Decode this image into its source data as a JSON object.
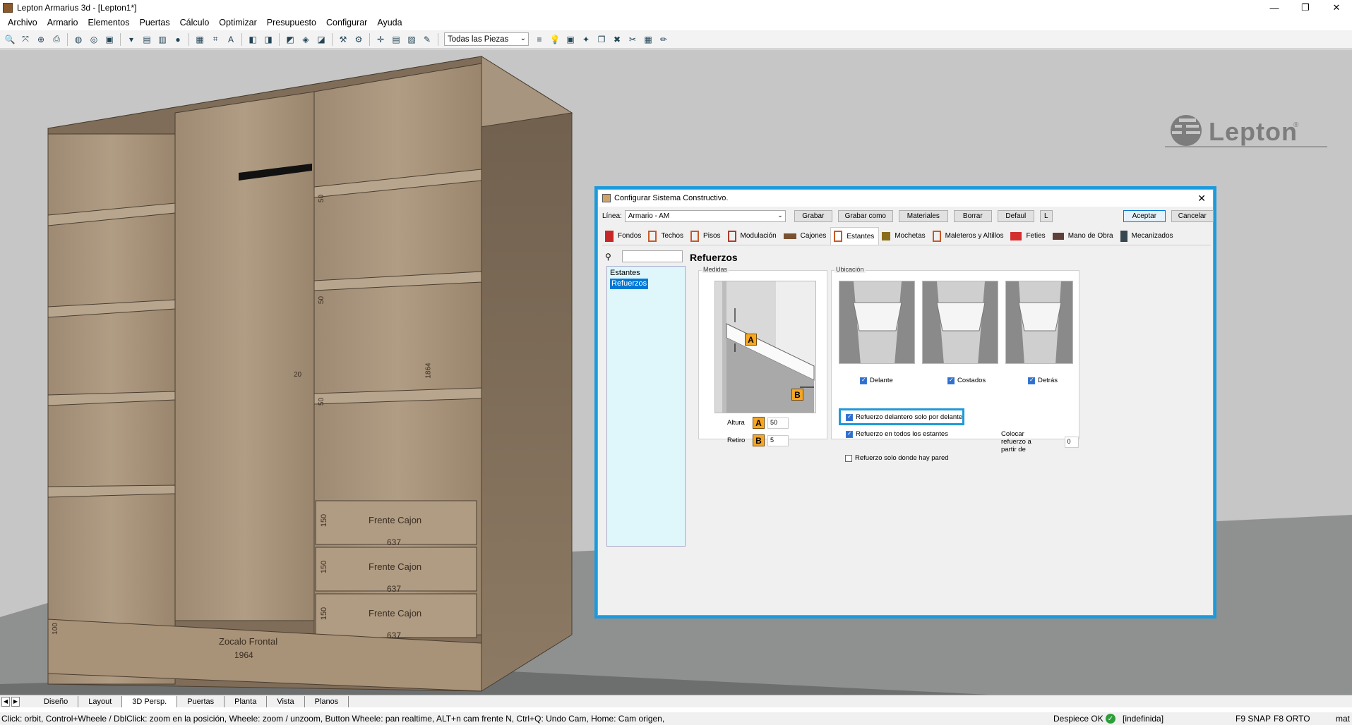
{
  "window": {
    "title": "Lepton Armarius 3d - [Lepton1*]",
    "minimize": "—",
    "maximize": "❐",
    "close": "✕"
  },
  "menu": [
    "Archivo",
    "Armario",
    "Elementos",
    "Puertas",
    "Cálculo",
    "Optimizar",
    "Presupuesto",
    "Configurar",
    "Ayuda"
  ],
  "toolbar": {
    "pieces_select": "Todas las Piezas"
  },
  "logo": {
    "text": "Lepton",
    "mark": "®"
  },
  "model_labels": {
    "drawer_front": "Frente Cajon",
    "drawer_width": "637",
    "drawer_height": "150",
    "shelf_height": "50",
    "side_dim": "1864",
    "center_dim": "20",
    "plinth": "Zocalo Frontal",
    "plinth_width": "1964",
    "plinth_height": "100"
  },
  "dialog": {
    "title": "Configurar Sistema Constructivo.",
    "linea_label": "Línea:",
    "linea_value": "Armario - AM",
    "buttons": {
      "grabar": "Grabar",
      "grabar_como": "Grabar como",
      "materiales": "Materiales",
      "borrar": "Borrar",
      "default": "Defaul",
      "l": "L",
      "aceptar": "Aceptar",
      "cancelar": "Cancelar"
    },
    "tabs": [
      {
        "label": "Fondos",
        "color": "#c62828"
      },
      {
        "label": "Techos",
        "color": "#c65a28"
      },
      {
        "label": "Pisos",
        "color": "#c65a28"
      },
      {
        "label": "Modulación",
        "color": "#b03a2e"
      },
      {
        "label": "Cajones",
        "color": "#7a5230"
      },
      {
        "label": "Estantes",
        "color": "#c65a28"
      },
      {
        "label": "Mochetas",
        "color": "#8a6d1a"
      },
      {
        "label": "Maleteros y Altillos",
        "color": "#c65a28"
      },
      {
        "label": "Feties",
        "color": "#d32f2f"
      },
      {
        "label": "Mano de Obra",
        "color": "#5d4037"
      },
      {
        "label": "Mecanizados",
        "color": "#37474f"
      }
    ],
    "active_tab": "Estantes",
    "tree": [
      "Estantes",
      "Refuerzos"
    ],
    "section_title": "Refuerzos",
    "medidas": {
      "label": "Medidas",
      "altura_label": "Altura",
      "altura_value": "50",
      "retiro_label": "Retiro",
      "retiro_value": "5",
      "badge_a": "A",
      "badge_b": "B"
    },
    "ubicacion": {
      "label": "Ubicación",
      "delante": "Delante",
      "costados": "Costados",
      "detras": "Detrás",
      "solo_delante": "Refuerzo delantero solo por delante",
      "todos": "Refuerzo en todos los estantes",
      "pared": "Refuerzo solo donde hay pared",
      "colocar_label": "Colocar refuerzo a partir de",
      "colocar_value": "0"
    }
  },
  "sheet_tabs": [
    "Diseño",
    "Layout",
    "3D Persp.",
    "Puertas",
    "Planta",
    "Vista",
    "Planos"
  ],
  "active_sheet": "3D Persp.",
  "status": {
    "hint": "Click: orbit, Control+Wheele / DblClick: zoom en la posición, Wheele: zoom / unzoom, Button Wheele: pan realtime, ALT+n cam frente N, Ctrl+Q: Undo Cam, Home: Cam origen,",
    "despiece": "Despiece OK",
    "indefinida": "[indefinida]",
    "snap": "F9 SNAP",
    "orto": "F8 ORTO",
    "mat": "mat"
  },
  "colors": {
    "highlight": "#1e9ad9",
    "wood": "#a08a72",
    "viewport": "#c6c6c6"
  }
}
